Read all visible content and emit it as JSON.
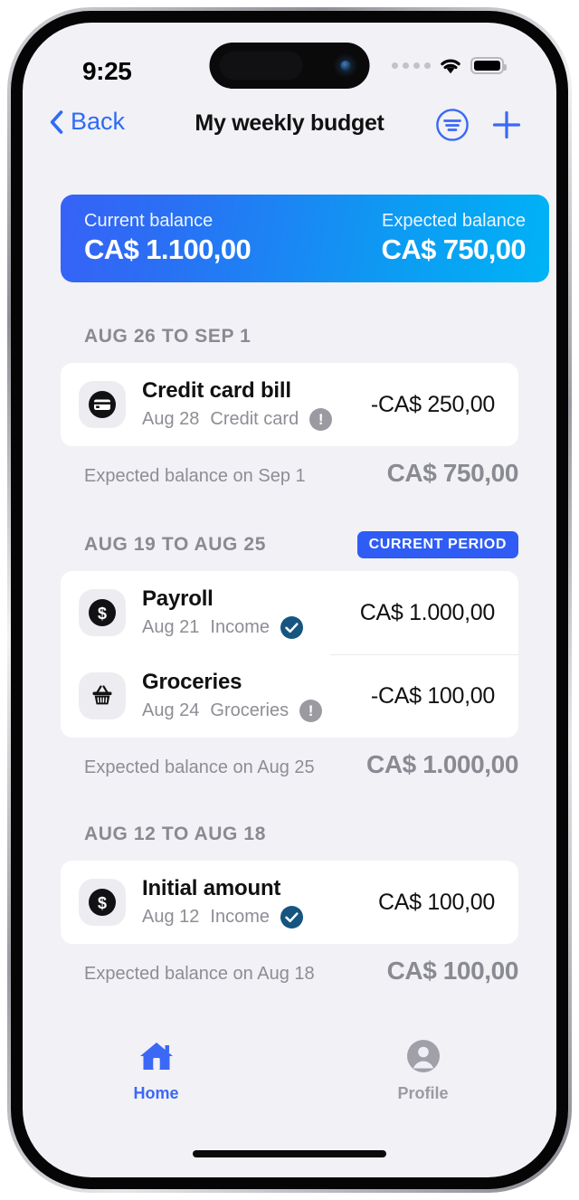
{
  "status_bar": {
    "time": "9:25",
    "cellular_icon": "cellular-dots-icon",
    "wifi_icon": "wifi-icon",
    "battery_icon": "battery-full-icon"
  },
  "nav": {
    "back_label": "Back",
    "back_icon": "chevron-left-icon",
    "title": "My weekly budget",
    "filter_icon": "filter-sort-icon",
    "add_icon": "plus-icon"
  },
  "balance": {
    "current_label": "Current balance",
    "current_value": "CA$ 1.100,00",
    "expected_label": "Expected balance",
    "expected_value": "CA$ 750,00",
    "gradient_start": "#3762F6",
    "gradient_end": "#00B3F6"
  },
  "sections": [
    {
      "title": "AUG 26 TO SEP 1",
      "badge": "",
      "transactions": [
        {
          "icon": "credit-card-icon",
          "name": "Credit card bill",
          "date": "Aug 28",
          "category": "Credit card",
          "status": "pending",
          "status_icon": "warning-icon",
          "amount": "-CA$ 250,00"
        }
      ],
      "footer_label": "Expected balance on Sep 1",
      "footer_value": "CA$ 750,00"
    },
    {
      "title": "AUG 19 TO AUG 25",
      "badge": "CURRENT PERIOD",
      "transactions": [
        {
          "icon": "dollar-coin-icon",
          "name": "Payroll",
          "date": "Aug 21",
          "category": "Income",
          "status": "done",
          "status_icon": "check-circle-icon",
          "amount": "CA$ 1.000,00"
        },
        {
          "icon": "basket-icon",
          "name": "Groceries",
          "date": "Aug 24",
          "category": "Groceries",
          "status": "pending",
          "status_icon": "warning-icon",
          "amount": "-CA$ 100,00"
        }
      ],
      "footer_label": "Expected balance on Aug 25",
      "footer_value": "CA$ 1.000,00"
    },
    {
      "title": "AUG 12 TO AUG 18",
      "badge": "",
      "transactions": [
        {
          "icon": "dollar-coin-icon",
          "name": "Initial amount",
          "date": "Aug 12",
          "category": "Income",
          "status": "done",
          "status_icon": "check-circle-icon",
          "amount": "CA$ 100,00"
        }
      ],
      "footer_label": "Expected balance on Aug 18",
      "footer_value": "CA$ 100,00"
    }
  ],
  "tabs": [
    {
      "label": "Home",
      "icon": "home-icon",
      "active": true,
      "color": "#3B68F5"
    },
    {
      "label": "Profile",
      "icon": "profile-avatar-icon",
      "active": false,
      "color": "#9A9AA2"
    }
  ]
}
